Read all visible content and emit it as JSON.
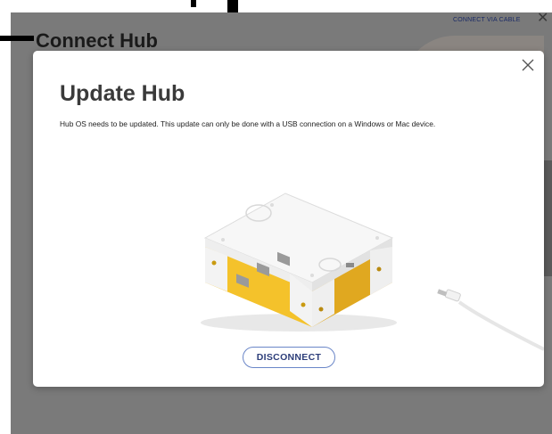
{
  "background": {
    "title": "Connect Hub",
    "connect_via_cable": "CONNECT VIA CABLE",
    "close_glyph": "✕"
  },
  "modal": {
    "title": "Update Hub",
    "description": "Hub OS needs to be updated. This update can only be done with a USB connection on a Windows or Mac device.",
    "disconnect_label": "DISCONNECT",
    "close_icon": "close-icon",
    "illustration_icon": "hub-usb-illustration"
  },
  "colors": {
    "hub_body": "#f4c22b",
    "hub_top": "#f7f7f7",
    "button_border": "#6a86c8",
    "button_text": "#2d3e7a"
  }
}
